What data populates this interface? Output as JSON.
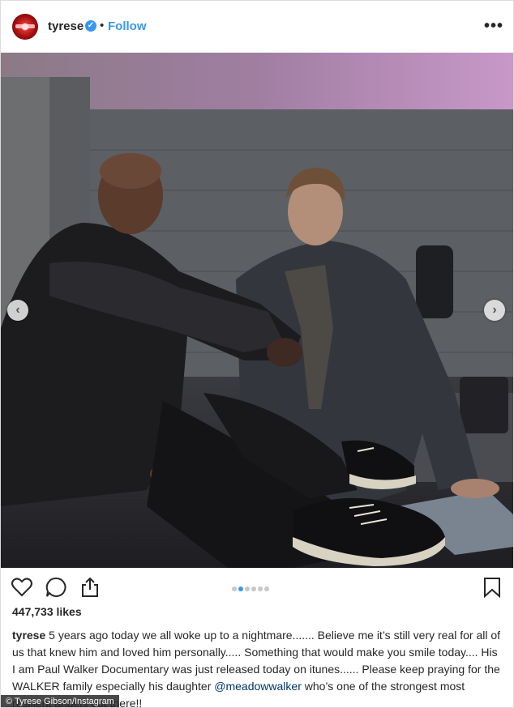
{
  "header": {
    "username": "tyrese",
    "separator": "•",
    "follow_label": "Follow",
    "more_label": "•••"
  },
  "carousel": {
    "prev_label": "‹",
    "next_label": "›",
    "slide_count": 6,
    "active_index": 1
  },
  "actions": {
    "icons": [
      "heart-icon",
      "comment-icon",
      "share-icon",
      "bookmark-icon"
    ]
  },
  "likes": "447,733 likes",
  "caption": {
    "username": "tyrese",
    "text_before": " 5 years ago today we all woke up to a nightmare....... Believe me it’s still very real for all of us that knew him and loved him personally..... Something that would make you smile today.... His I am Paul Walker Documentary was just released today on itunes...... Please keep praying for the WALKER family especially his daughter ",
    "mention": "@meadowwalker",
    "text_after": " who’s one of the strongest most resilient angels out there!!"
  },
  "watermark": "© Tyrese Gibson/Instagram",
  "colors": {
    "accent": "#3897f0",
    "text": "#262626",
    "mention": "#003569",
    "border": "#dbdbdb"
  }
}
